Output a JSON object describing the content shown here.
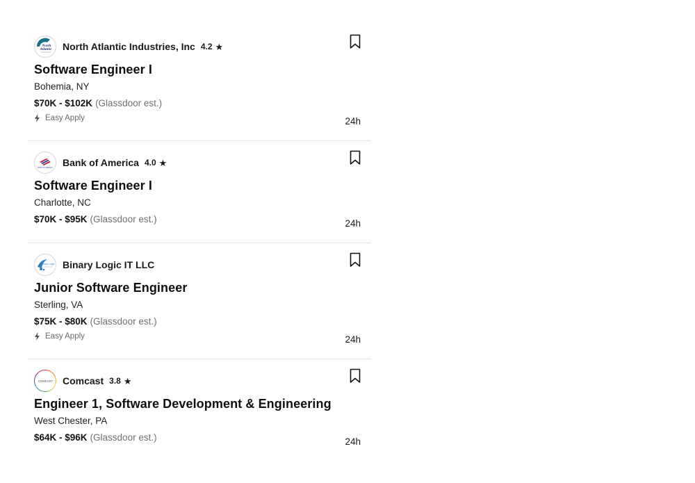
{
  "jobs": [
    {
      "company": "North Atlantic Industries, Inc",
      "rating": "4.2",
      "logo_icon": "north-atlantic-logo",
      "title": "Software Engineer I",
      "location": "Bohemia, NY",
      "salary": "$70K - $102K",
      "salary_note": "(Glassdoor est.)",
      "easy_apply": "Easy Apply",
      "age": "24h"
    },
    {
      "company": "Bank of America",
      "rating": "4.0",
      "logo_icon": "bank-of-america-logo",
      "title": "Software Engineer I",
      "location": "Charlotte, NC",
      "salary": "$70K - $95K",
      "salary_note": "(Glassdoor est.)",
      "easy_apply": null,
      "age": "24h"
    },
    {
      "company": "Binary Logic IT LLC",
      "rating": null,
      "logo_icon": "binary-logic-logo",
      "title": "Junior Software Engineer",
      "location": "Sterling, VA",
      "salary": "$75K - $80K",
      "salary_note": "(Glassdoor est.)",
      "easy_apply": "Easy Apply",
      "age": "24h"
    },
    {
      "company": "Comcast",
      "rating": "3.8",
      "logo_icon": "comcast-logo",
      "title": "Engineer 1, Software Development & Engineering",
      "location": "West Chester, PA",
      "salary": "$64K - $96K",
      "salary_note": "(Glassdoor est.)",
      "easy_apply": null,
      "age": "24h"
    }
  ],
  "star_glyph": "★",
  "logos": {
    "north_atlantic": [
      "North",
      "Atlantic"
    ],
    "bank_of_america": "BANK OF AMERICA",
    "binary_logic": "Binary Logic",
    "comcast": "COMCAST"
  }
}
